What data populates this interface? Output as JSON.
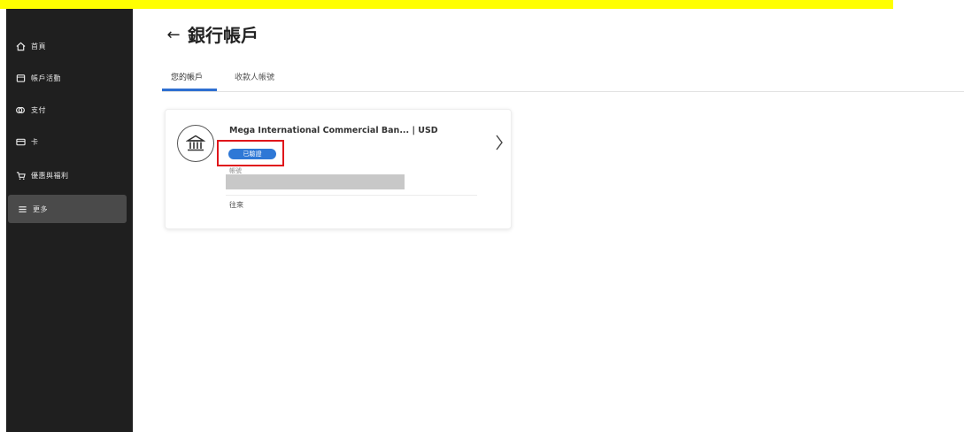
{
  "sidebar": {
    "items": [
      {
        "label": "首頁",
        "icon": "home-icon"
      },
      {
        "label": "帳戶活動",
        "icon": "activity-icon"
      },
      {
        "label": "支付",
        "icon": "payment-icon"
      },
      {
        "label": "卡",
        "icon": "card-icon"
      },
      {
        "label": "優惠與福利",
        "icon": "offers-icon"
      },
      {
        "label": "更多",
        "icon": "menu-icon",
        "active": true
      }
    ]
  },
  "header": {
    "back_label": "←",
    "title": "銀行帳戶"
  },
  "tabs": [
    {
      "label": "您的帳戶",
      "active": true
    },
    {
      "label": "收款人帳號",
      "active": false
    }
  ],
  "account": {
    "bank_name": "Mega International Commercial Ban... | USD",
    "status": "已驗證",
    "account_label": "帳號",
    "type": "往來"
  },
  "colors": {
    "sidebar_bg": "#1f1f1f",
    "accent": "#2e78d6",
    "banner": "#ffff00",
    "highlight": "#e0161b"
  }
}
